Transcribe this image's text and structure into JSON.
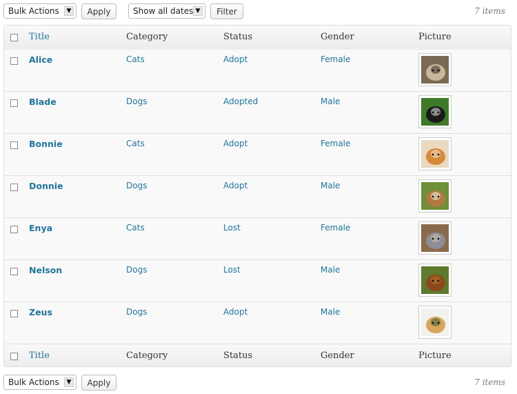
{
  "top_nav": {
    "bulk_actions": "Bulk Actions",
    "apply": "Apply",
    "dates": "Show all dates",
    "filter": "Filter",
    "count": "7 items"
  },
  "bottom_nav": {
    "bulk_actions": "Bulk Actions",
    "apply": "Apply",
    "count": "7 items"
  },
  "columns": {
    "title": "Title",
    "category": "Category",
    "status": "Status",
    "gender": "Gender",
    "picture": "Picture"
  },
  "rows": [
    {
      "title": "Alice",
      "category": "Cats",
      "status": "Adopt",
      "gender": "Female",
      "picture": "tabby-cat-photo",
      "colors": [
        "#7a6a55",
        "#c9b79c",
        "#3b3128"
      ]
    },
    {
      "title": "Blade",
      "category": "Dogs",
      "status": "Adopted",
      "gender": "Male",
      "picture": "black-dog-photo",
      "colors": [
        "#3f7a2a",
        "#1a1a1a",
        "#e8e8e8"
      ]
    },
    {
      "title": "Bonnie",
      "category": "Cats",
      "status": "Adopt",
      "gender": "Female",
      "picture": "orange-cat-photo",
      "colors": [
        "#e8d9c0",
        "#d7893a",
        "#f2e6d6"
      ]
    },
    {
      "title": "Donnie",
      "category": "Dogs",
      "status": "Adopt",
      "gender": "Male",
      "picture": "beagle-photo",
      "colors": [
        "#6f8f3a",
        "#b07a3c",
        "#f3efe6"
      ]
    },
    {
      "title": "Enya",
      "category": "Cats",
      "status": "Lost",
      "gender": "Female",
      "picture": "grey-cat-photo",
      "colors": [
        "#8a6a4c",
        "#8e8e96",
        "#c9c2b7"
      ]
    },
    {
      "title": "Nelson",
      "category": "Dogs",
      "status": "Lost",
      "gender": "Male",
      "picture": "spaniel-photo",
      "colors": [
        "#5f7a2e",
        "#8c4a1c",
        "#b9742f"
      ]
    },
    {
      "title": "Zeus",
      "category": "Dogs",
      "status": "Adopt",
      "gender": "Male",
      "picture": "golden-puppy-photo",
      "colors": [
        "#f1f1ee",
        "#d7a65c",
        "#3b5e2c"
      ]
    }
  ]
}
